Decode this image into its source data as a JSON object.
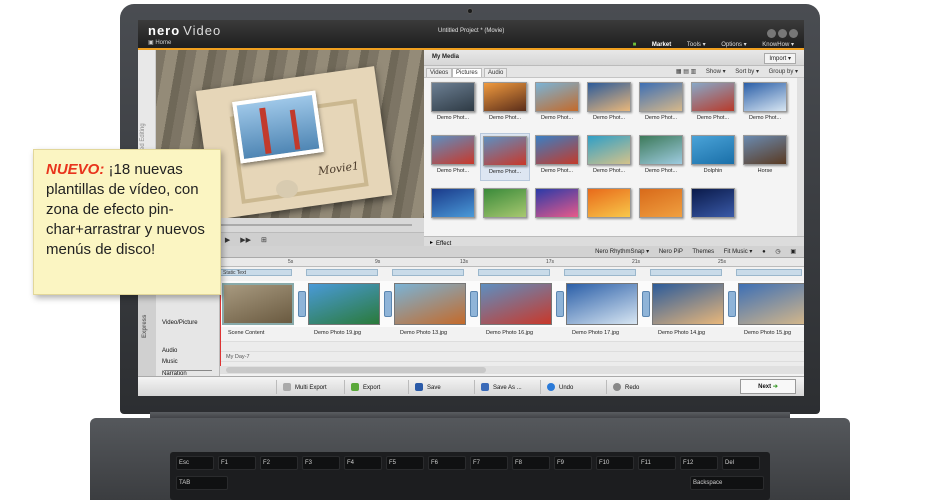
{
  "app": {
    "logo": "nero",
    "logo_product": "Video",
    "home": "Home",
    "project_title": "Untitled Project * (Movie)",
    "menu": [
      "Market",
      "Tools ▾",
      "Options ▾",
      "KnowHow ▾"
    ]
  },
  "preview": {
    "side_label": "Advanced Editing",
    "overlay_text": "Movie1"
  },
  "media": {
    "title": "My Media",
    "import_label": "Import ▾",
    "tabs": [
      "Videos",
      "Pictures",
      "Audio"
    ],
    "tools": [
      "Show ▾",
      "Sort by ▾",
      "Group by ▾"
    ],
    "items": [
      {
        "label": "Demo Phot...",
        "c1": "#6c7f93",
        "c2": "#2e3a44"
      },
      {
        "label": "Demo Phot...",
        "c1": "#f09a3e",
        "c2": "#5a2d1a"
      },
      {
        "label": "Demo Phot...",
        "c1": "#7ab3d6",
        "c2": "#c46a2a"
      },
      {
        "label": "Demo Phot...",
        "c1": "#2c5b9a",
        "c2": "#e9b77a"
      },
      {
        "label": "Demo Phot...",
        "c1": "#3d6fb5",
        "c2": "#d7b889"
      },
      {
        "label": "Demo Phot...",
        "c1": "#87a8c8",
        "c2": "#b83a2a"
      },
      {
        "label": "Demo Phot...",
        "c1": "#2b5fa8",
        "c2": "#d8e6f2"
      },
      {
        "label": "Demo Phot...",
        "c1": "#5d8fc1",
        "c2": "#c9382a"
      },
      {
        "label": "Demo Phot...",
        "c1": "#5d8fc1",
        "c2": "#c9382a"
      },
      {
        "label": "Demo Phot...",
        "c1": "#3a7fc4",
        "c2": "#c43a2a"
      },
      {
        "label": "Demo Phot...",
        "c1": "#2f9fc7",
        "c2": "#d4c28a"
      },
      {
        "label": "Demo Phot...",
        "c1": "#3d7a5a",
        "c2": "#9ecbe0"
      },
      {
        "label": "Dolphin",
        "c1": "#4aa3d8",
        "c2": "#1a6fa8"
      },
      {
        "label": "Horse",
        "c1": "#6a8ab0",
        "c2": "#5a3a22"
      },
      {
        "label": "",
        "c1": "#1a3a8a",
        "c2": "#4a9ad8"
      },
      {
        "label": "",
        "c1": "#3a8a3a",
        "c2": "#a8c870"
      },
      {
        "label": "",
        "c1": "#2a3aa8",
        "c2": "#e85a8a"
      },
      {
        "label": "",
        "c1": "#e86a1a",
        "c2": "#f8c84a"
      },
      {
        "label": "",
        "c1": "#d86a1a",
        "c2": "#f0a040"
      },
      {
        "label": "",
        "c1": "#0a1a4a",
        "c2": "#3a5aa8"
      }
    ],
    "effect_palette": "Effect Palette"
  },
  "toolbar2": [
    "Nero RhythmSnap ▾",
    "Nero PiP",
    "Themes",
    "Fit Music ▾"
  ],
  "timeline": {
    "side_label": "Express",
    "tracks": [
      "Video/Picture",
      "Audio",
      "Music",
      "Narration"
    ],
    "ruler": [
      "5s",
      "9s",
      "13s",
      "17s",
      "21s",
      "25s"
    ],
    "static_text": "Static Text",
    "music_clip": "My Day-7",
    "clips": [
      {
        "name": "Scene Content",
        "c1": "#a89a80",
        "c2": "#6a5a40"
      },
      {
        "name": "Demo Photo 19.jpg",
        "c1": "#4a9ad8",
        "c2": "#2a7a3a"
      },
      {
        "name": "Demo Photo 13.jpg",
        "c1": "#7ab3d6",
        "c2": "#c46a2a"
      },
      {
        "name": "Demo Photo 16.jpg",
        "c1": "#5d8fc1",
        "c2": "#c9382a"
      },
      {
        "name": "Demo Photo 17.jpg",
        "c1": "#2b5fa8",
        "c2": "#d8e6f2"
      },
      {
        "name": "Demo Photo 14.jpg",
        "c1": "#2c5b9a",
        "c2": "#e9b77a"
      },
      {
        "name": "Demo Photo 15.jpg",
        "c1": "#3d6fb5",
        "c2": "#d7b889"
      }
    ]
  },
  "bottom": {
    "multi_export": "Multi Export",
    "export": "Export",
    "save": "Save",
    "save_as": "Save As ...",
    "undo": "Undo",
    "redo": "Redo",
    "next": "Next"
  },
  "note": {
    "highlight": "NUEVO:",
    "text": " ¡18 nuevas plantillas de vídeo, con zona de efecto pin-char+arrastrar y nuevos menús de disco!"
  },
  "keyboard": [
    "Esc",
    "F1",
    "F2",
    "F3",
    "F4",
    "F5",
    "F6",
    "F7",
    "F8",
    "F9",
    "F10",
    "F11",
    "F12",
    "Del",
    "TAB",
    "Backspace"
  ]
}
